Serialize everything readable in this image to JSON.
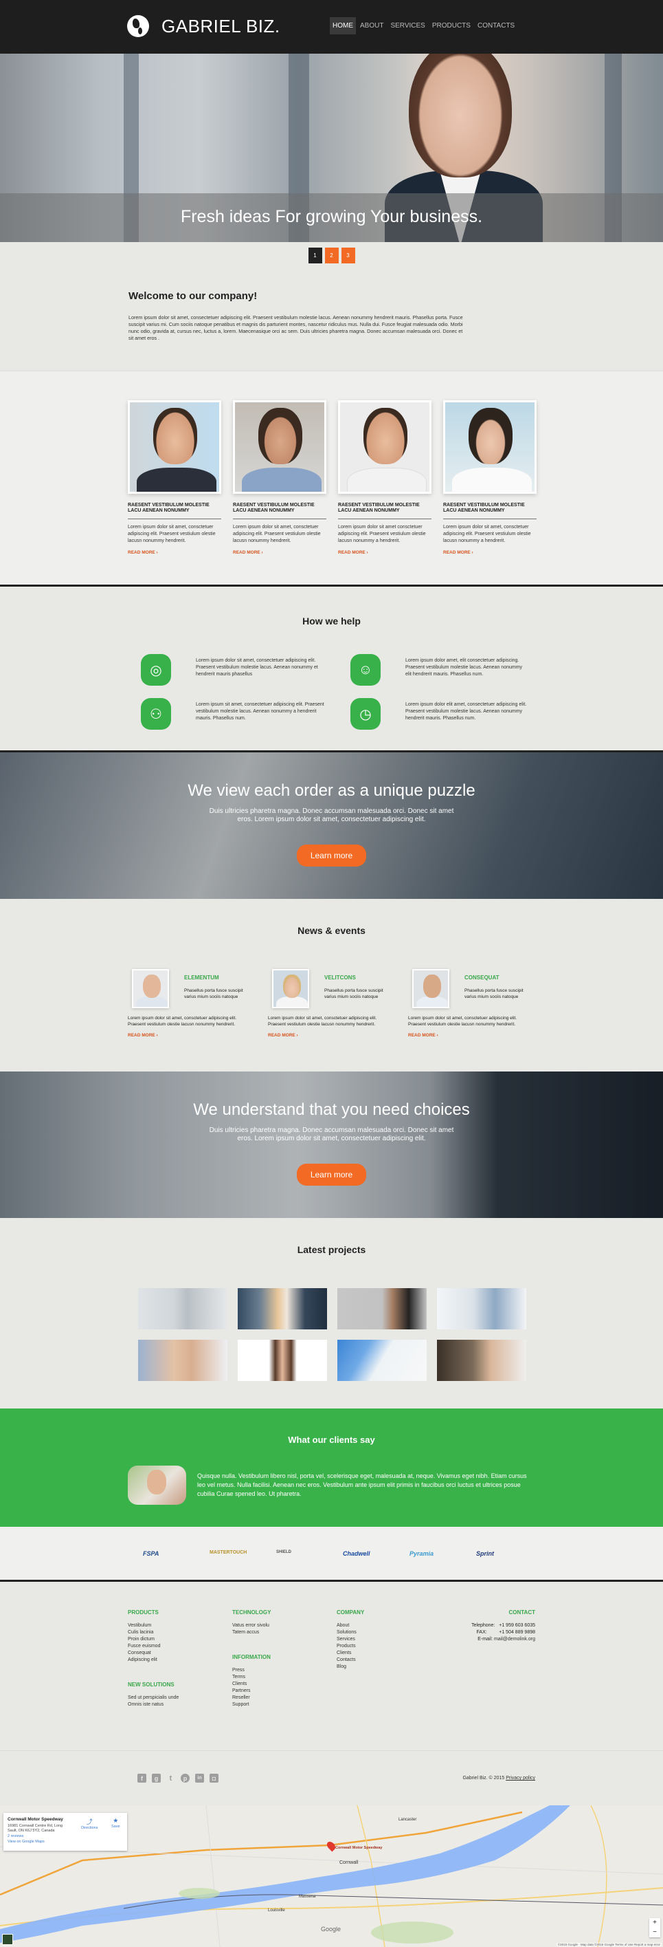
{
  "header": {
    "logo_text": "GABRIEL BIZ.",
    "logo_icon": "globe-icon",
    "nav": [
      "HOME",
      "ABOUT",
      "SERVICES",
      "PRODUCTS",
      "CONTACTS"
    ],
    "active_nav": "HOME"
  },
  "hero": {
    "title": "Fresh ideas For growing Your business.",
    "pager": [
      "1",
      "2",
      "3"
    ],
    "active_page": "1"
  },
  "welcome": {
    "title": "Welcome to our company!",
    "text": "Lorem ipsum dolor sit amet, consectetuer adipiscing elit. Praesent vestibulum molestie lacus. Aenean nonummy hendrerit mauris. Phasellus porta. Fusce suscipit varius mi. Cum sociis natoque penatibus et magnis dis parturient montes, nascetur ridiculus mus. Nulla dui. Fusce feugiat malesuada odio. Morbi nunc odio, gravida at, cursus nec, luctus a, lorem. Maecenasique orci ac sem. Duis ultricies pharetra magna. Donec accumsan malesuada orci. Donec et sit amet eros ."
  },
  "team": [
    {
      "title": "RAESENT VESTIBULUM MOLESTIE LACU AENEAN NONUMMY",
      "text": "Lorem ipsum dolor sit amet, consctetuer adipiscing elit. Praesent vestiulum olestie lacusn nonummy hendrerit.",
      "link": "READ MORE"
    },
    {
      "title": "RAESENT VESTIBULUM MOLESTIE LACU AENEAN NONUMMY",
      "text": "Lorem ipsum dolor sit amet, consctetuer adipiscing elit. Praesent vestiulum olestie lacusn nonummy hendrerit.",
      "link": "READ MORE"
    },
    {
      "title": "RAESENT VESTIBULUM MOLESTIE LACU AENEAN NONUMMY",
      "text": "Lorem ipsum dolor sit amet consctetuer adipiscing elit. Praesent vestiulum olestie lacusn nonummy a hendrerit.",
      "link": "READ MORE"
    },
    {
      "title": "RAESENT VESTIBULUM MOLESTIE LACU AENEAN NONUMMY",
      "text": "Lorem ipsum dolor sit amet, consctetuer adipiscing elit. Praesent vestiulum olestie lacusn nonummy a hendrerit.",
      "link": "READ MORE"
    }
  ],
  "help": {
    "title": "How we help",
    "items": [
      {
        "icon": "target-icon",
        "glyph": "◎",
        "text": "Lorem ipsum dolor sit amet, consectetuer adipiscing elit. Praesent vestibulum molestie lacus. Aenean nonummy et hendrerit mauris phasellus"
      },
      {
        "icon": "idea-person-icon",
        "glyph": "☺",
        "text": "Lorem ipsum dolor amet, elit consectetuer adipiscing. Praesent vestibulum molestie lacus. Aenean nonummy elit hendrerit mauris. Phasellus num."
      },
      {
        "icon": "team-meeting-icon",
        "glyph": "⚇",
        "text": "Lorem ipsum sit amet, consectetuer adipiscing elit. Praesent vestibulum molestie lacus. Aenean nonummy a hendrerit mauris. Phasellus num."
      },
      {
        "icon": "time-money-icon",
        "glyph": "◷",
        "text": "Lorem ipsum dolor elit amet, consectetuer adipiscing elit. Praesent vestibulum molestie lacus. Aenean nonummy hendrerit mauris. Phasellus num."
      }
    ]
  },
  "banner1": {
    "title": "We view each order as a unique puzzle",
    "text": "Duis ultricies pharetra magna. Donec accumsan malesuada orci. Donec sit amet eros. Lorem ipsum dolor sit amet, consectetuer adipiscing elit.",
    "button": "Learn more"
  },
  "news": {
    "title": "News & events",
    "items": [
      {
        "heading": "ELEMENTUM",
        "summary": "Phasellus porta fusce suscipit varius mium sociis natoque",
        "text": "Lorem ipsum dolor sit amet, consctetuer adipiscing elit. Praesent vestiulum olestie lacusn nonummy hendrerit.",
        "link": "READ MORE"
      },
      {
        "heading": "VELITCONS",
        "summary": "Phasellus porta fusce suscipit varius mium sociis natoque",
        "text": "Lorem ipsum dolor sit amet, consctetuer adipiscing elit. Praesent vestiulum olestie lacusn nonummy hendrerit.",
        "link": "READ MORE"
      },
      {
        "heading": "CONSEQUAT",
        "summary": "Phasellus porta fusce suscipit varius mium sociis natoque",
        "text": "Lorem ipsum dolor sit amet, consctetuer adipiscing elit. Praesent vestiulum olestie lacusn nonummy hendrerit.",
        "link": "READ MORE"
      }
    ]
  },
  "banner2": {
    "title": "We understand that you need choices",
    "text": "Duis ultricies pharetra magna. Donec accumsan malesuada orci. Donec sit amet eros. Lorem ipsum dolor sit amet, consectetuer adipiscing elit.",
    "button": "Learn more"
  },
  "projects": {
    "title": "Latest projects",
    "count": 8
  },
  "testimonials": {
    "title": "What our clients say",
    "text": "Quisque nulla. Vestibulum libero nisl, porta vel, scelerisque eget, malesuada at, neque. Vivamus eget nibh. Etiam cursus leo vel metus. Nulla facilisi. Aenean nec eros. Vestibulum ante ipsum elit primis in faucibus orci luctus et ultrices posue cubilia Curae spened leo. Ut pharetra."
  },
  "partners": [
    "FSPA",
    "MASTERTOUCH",
    "SHIELD",
    "Chadwell",
    "Pyramia",
    "Sprint"
  ],
  "footer": {
    "products": {
      "title": "PRODUCTS",
      "links": [
        "Vestibulum",
        "Culis lacinia",
        "Proin dictum",
        "Fusce euismod",
        "Consequat",
        "Adipiscing elit"
      ]
    },
    "new_solutions": {
      "title": "NEW SOLUTIONS",
      "links": [
        "Sed ut perspicialis unde",
        "Omnis iste natus"
      ]
    },
    "technology": {
      "title": "TECHNOLOGY",
      "links": [
        "Vatus error sivolu",
        "Tatem accus"
      ]
    },
    "information": {
      "title": "INFORMATION",
      "links": [
        "Press",
        "Terms",
        "Clients",
        "Partners",
        "Reseller",
        "Support"
      ]
    },
    "company": {
      "title": "COMPANY",
      "links": [
        "About",
        "Solutions",
        "Services",
        "Products",
        "Clients",
        "Contacts",
        "Blog"
      ]
    },
    "contact": {
      "title": "CONTACT",
      "telephone_label": "Telephone:",
      "telephone": "+1 959 603 6035",
      "fax_label": "FAX:",
      "fax": "+1 504 889 9898",
      "email_label": "E-mail:",
      "email": "mail@demolink.org"
    },
    "social": [
      {
        "name": "facebook-icon",
        "glyph": "f"
      },
      {
        "name": "google-plus-icon",
        "glyph": "g"
      },
      {
        "name": "twitter-icon",
        "glyph": "t"
      },
      {
        "name": "pinterest-icon",
        "glyph": "p"
      },
      {
        "name": "linkedin-icon",
        "glyph": "in"
      },
      {
        "name": "instagram-icon",
        "glyph": "◘"
      }
    ],
    "copyright": "Gabriel Biz. © 2015",
    "privacy": "Privacy policy"
  },
  "map": {
    "place_name": "Cornwall Motor Speedway",
    "address": "16981 Cornwall Centre Rd, Long Sault, ON K6J 5Y2, Canada",
    "reviews": "2 reviews",
    "view_link": "View on Google Maps",
    "directions": "Directions",
    "save": "Save",
    "pin_label": "Cornwall Motor Speedway",
    "cities": [
      "Cornwall",
      "Massena",
      "Louisville",
      "Lancaster"
    ],
    "google": "Google",
    "attribution": "©2015 Google · Map data ©2015 Google   Terms of Use   Report a map error",
    "zoom_in": "+",
    "zoom_out": "−"
  },
  "colors": {
    "accent_orange": "#f26a24",
    "accent_green": "#38b14a",
    "header_bg": "#1e1e1e"
  }
}
